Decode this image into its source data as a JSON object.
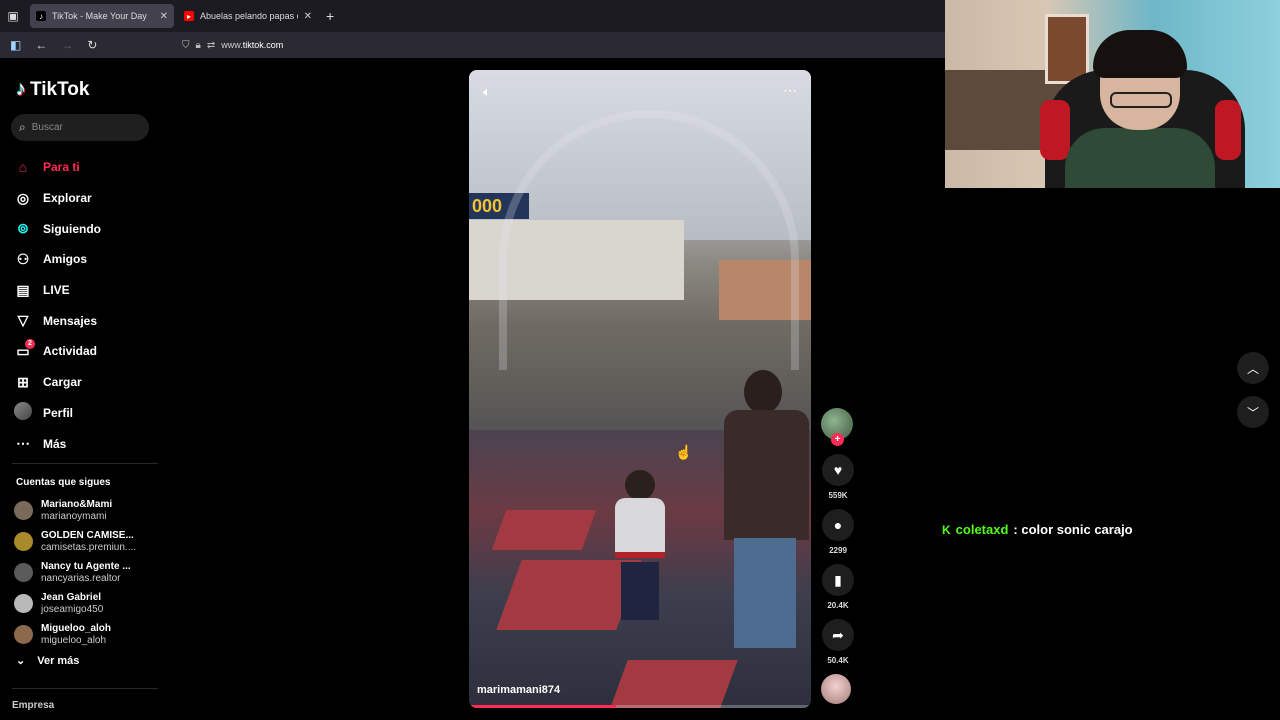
{
  "browser": {
    "tabs": [
      {
        "title": "TikTok - Make Your Day",
        "active": true
      },
      {
        "title": "Abuelas pelando papas con mú",
        "active": false
      }
    ],
    "url_prefix": "www.",
    "url_domain": "tiktok.com"
  },
  "sidebar": {
    "logo": "TikTok",
    "search_placeholder": "Buscar",
    "menu": [
      {
        "label": "Para ti",
        "icon": "home-icon",
        "active": true
      },
      {
        "label": "Explorar",
        "icon": "compass-icon"
      },
      {
        "label": "Siguiendo",
        "icon": "following-icon"
      },
      {
        "label": "Amigos",
        "icon": "friends-icon"
      },
      {
        "label": "LIVE",
        "icon": "live-icon"
      },
      {
        "label": "Mensajes",
        "icon": "messages-icon"
      },
      {
        "label": "Actividad",
        "icon": "activity-icon",
        "badge": "2"
      },
      {
        "label": "Cargar",
        "icon": "upload-icon"
      },
      {
        "label": "Perfil",
        "icon": "profile-avatar"
      },
      {
        "label": "Más",
        "icon": "more-icon"
      }
    ],
    "following_title": "Cuentas que sigues",
    "following": [
      {
        "name": "Mariano&Mami",
        "handle": "marianoymami",
        "color": "#7a6a5a"
      },
      {
        "name": "GOLDEN CAMISE...",
        "handle": "camisetas.premiun....",
        "color": "#a88a2a"
      },
      {
        "name": "Nancy tu Agente ...",
        "handle": "nancyarias.realtor",
        "color": "#5a5a5a"
      },
      {
        "name": "Jean Gabriel",
        "handle": "joseamigo450",
        "color": "#b9b9b9"
      },
      {
        "name": "Migueloo_aloh",
        "handle": "migueloo_aloh",
        "color": "#8a6a4a"
      }
    ],
    "see_more": "Ver más",
    "footer": "Empresa"
  },
  "video": {
    "username": "marimamani874",
    "sign_text": "000",
    "progress": 0.43,
    "likes": "559K",
    "comments": "2299",
    "saves": "20.4K",
    "shares": "50.4K"
  },
  "chat": {
    "user": "coletaxd",
    "message": ": color sonic carajo",
    "accent": "#53fc18"
  },
  "colors": {
    "accent": "#fe2c55",
    "background": "#000000"
  }
}
